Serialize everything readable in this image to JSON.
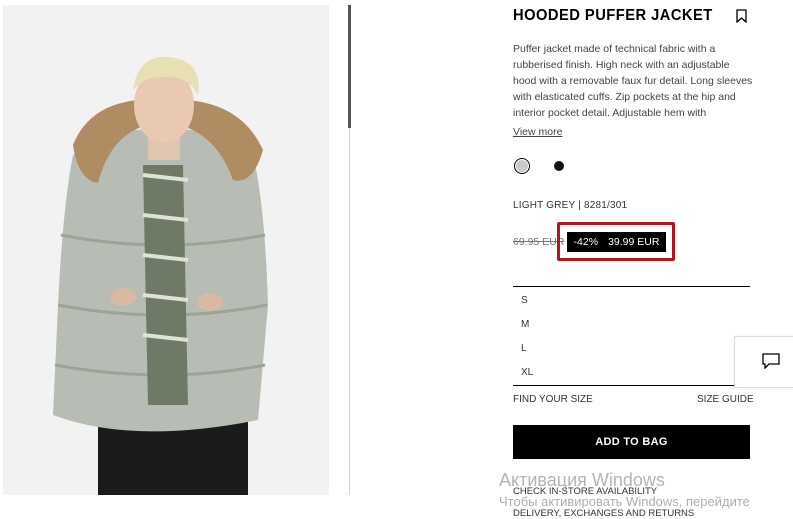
{
  "product": {
    "title": "HOODED PUFFER JACKET",
    "description": "Puffer jacket made of technical fabric with a rubberised finish. High neck with an adjustable hood with a removable faux fur detail. Long sleeves with elasticated cuffs. Zip pockets at the hip and interior pocket detail. Adjustable hem with",
    "view_more": "View more",
    "color_code": "LIGHT GREY | 8281/301",
    "colors": [
      {
        "name": "light-grey",
        "hex": "#c9c9c9",
        "selected": true
      },
      {
        "name": "black",
        "hex": "#111111",
        "selected": false
      }
    ],
    "old_price": "69.95 EUR",
    "discount": "-42%",
    "sale_price": "39.99 EUR"
  },
  "sizes": [
    "S",
    "M",
    "L",
    "XL"
  ],
  "links": {
    "find_size": "FIND YOUR SIZE",
    "size_guide": "SIZE GUIDE",
    "check_store": "CHECK IN-STORE AVAILABILITY",
    "delivery": "DELIVERY, EXCHANGES AND RETURNS"
  },
  "add_to_bag": "ADD TO BAG",
  "icons": {
    "bookmark": "bookmark-icon",
    "chat": "chat-icon"
  },
  "watermark": {
    "line1": "Активация Windows",
    "line2": "Чтобы активировать Windows, перейдите"
  },
  "colors_theme": {
    "highlight": "#b5141c",
    "tag_bg": "#000000"
  }
}
